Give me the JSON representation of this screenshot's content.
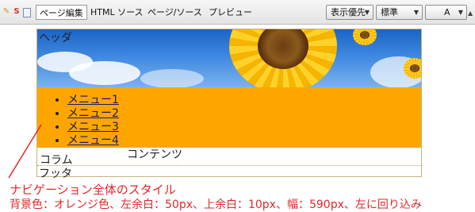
{
  "toolbar": {
    "tabs": [
      {
        "label": "ページ編集",
        "active": true
      },
      {
        "label": "HTML ソース",
        "active": false
      },
      {
        "label": "ページ/ソース",
        "active": false
      },
      {
        "label": "プレビュー",
        "active": false
      }
    ],
    "dropdowns": {
      "display": "表示優先",
      "style": "標準",
      "font": "A"
    },
    "icons": [
      "pencil-icon",
      "s-icon",
      "document-icon"
    ]
  },
  "preview": {
    "header_label": "ヘッダ",
    "nav_items": [
      "メニュー1",
      "メニュー2",
      "メニュー3",
      "メニュー4"
    ],
    "content_label": "コンテンツ",
    "column_label": "コラム",
    "footer_label": "フッタ",
    "colors": {
      "nav_background": "#ffa500",
      "sky": "#3d87e0"
    }
  },
  "annotation": {
    "title": "ナビゲーション全体のスタイル",
    "description": "背景色：オレンジ色、左余白：50px、上余白：10px、幅：590px、左に回り込み",
    "color": "#e4262a"
  }
}
